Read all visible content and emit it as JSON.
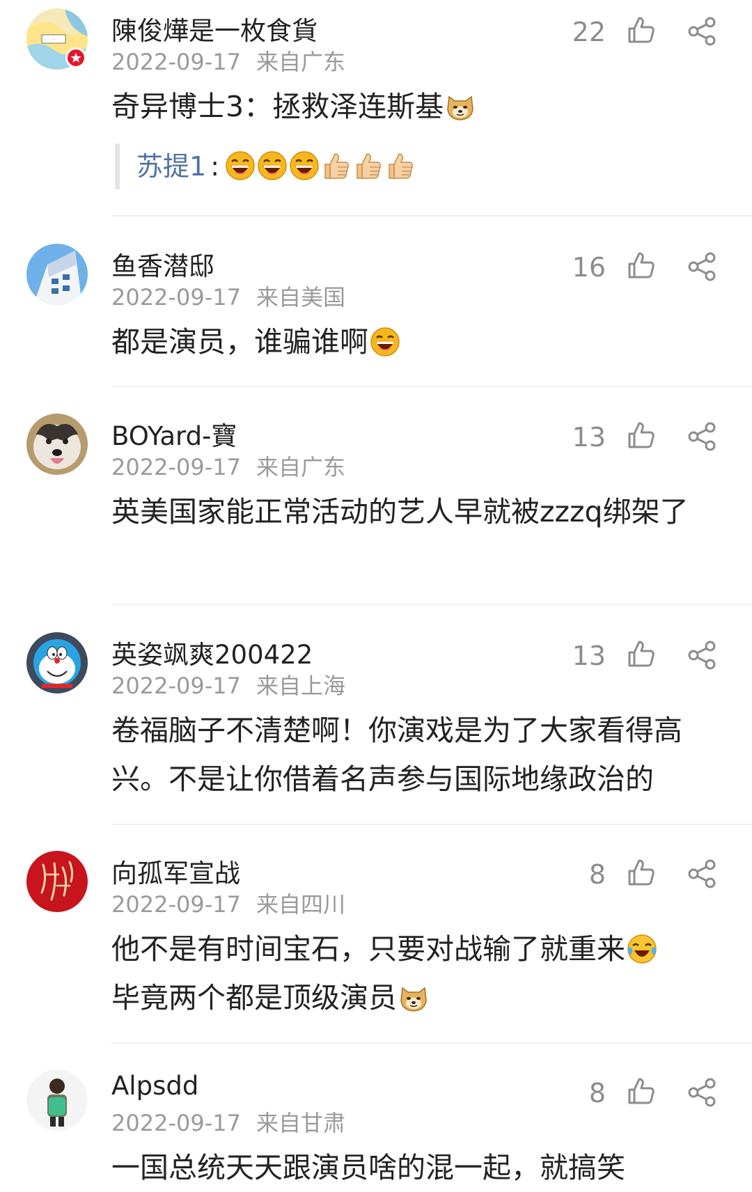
{
  "comments": [
    {
      "name": "陳俊燁是一枚食貨",
      "date": "2022-09-17",
      "location": "来自广东",
      "likes": "22",
      "text": "奇异博士3：拯救泽连斯基",
      "reply": {
        "name": "苏提1",
        "colon": ":"
      }
    },
    {
      "name": "鱼香潜邸",
      "date": "2022-09-17",
      "location": "来自美国",
      "likes": "16",
      "text": "都是演员，谁骗谁啊"
    },
    {
      "name": "BOYard-寶",
      "date": "2022-09-17",
      "location": "来自广东",
      "likes": "13",
      "text": "英美国家能正常活动的艺人早就被zzzq绑架了"
    },
    {
      "name": "英姿飒爽200422",
      "date": "2022-09-17",
      "location": "来自上海",
      "likes": "13",
      "text": "卷福脑子不清楚啊！你演戏是为了大家看得高兴。不是让你借着名声参与国际地缘政治的"
    },
    {
      "name": "向孤军宣战",
      "date": "2022-09-17",
      "location": "来自四川",
      "likes": "8",
      "text_line1": "他不是有时间宝石，只要对战输了就重来",
      "text_line2": "毕竟两个都是顶级演员"
    },
    {
      "name": "Alpsdd",
      "date": "2022-09-17",
      "location": "来自甘肃",
      "likes": "8",
      "text": "一国总统天天跟演员啥的混一起，就搞笑"
    }
  ],
  "icons": {
    "like": "thumbs-up-outline-icon",
    "share": "share-nodes-icon",
    "doge": "doge-emoji-icon",
    "laugh": "laughing-emoji-icon",
    "thumb": "thumbs-up-emoji-icon",
    "cry_laugh": "tears-of-joy-emoji-icon"
  },
  "colors": {
    "reply_name": "#4f72a3",
    "meta": "#9a9a9a",
    "text": "#222222",
    "badge": "#e6162d"
  }
}
